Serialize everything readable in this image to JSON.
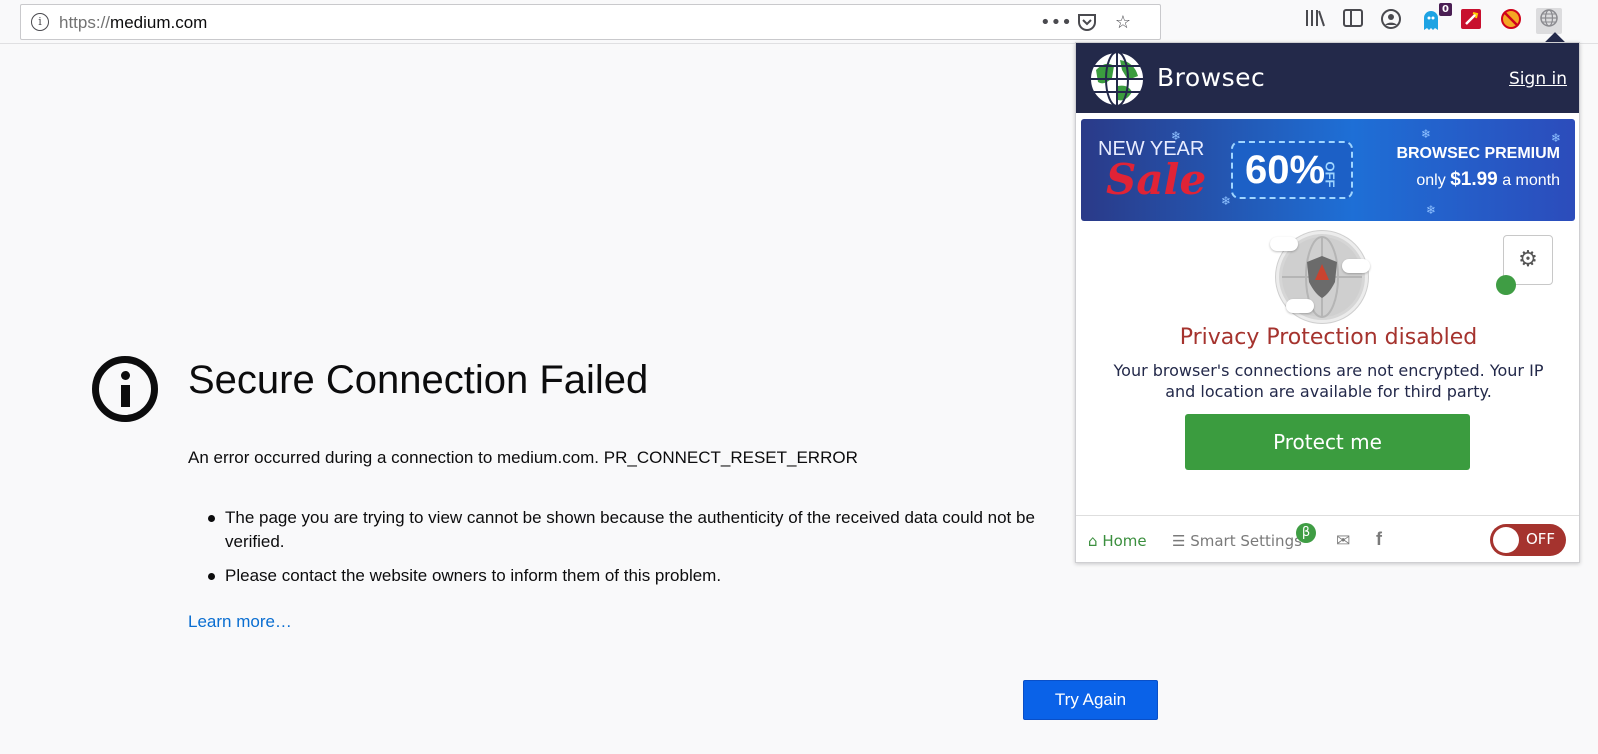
{
  "browser": {
    "url_protocol": "https://",
    "url_host": "medium.com",
    "icons": [
      "info-icon",
      "more-icon",
      "pocket-icon",
      "bookmark-star-icon",
      "library-icon",
      "sidebar-icon",
      "account-icon",
      "ghostery-icon",
      "flash-icon",
      "blocker-icon",
      "browsec-icon"
    ],
    "ghostery_badge": "0"
  },
  "error_page": {
    "title": "Secure Connection Failed",
    "description": "An error occurred during a connection to medium.com. PR_CONNECT_RESET_ERROR",
    "bullets": [
      "The page you are trying to view cannot be shown because the authenticity of the received data could not be verified.",
      "Please contact the website owners to inform them of this problem."
    ],
    "learn_more": "Learn more…",
    "try_again": "Try Again",
    "colors": {
      "link": "#0a6ed1",
      "button": "#0a62e8"
    }
  },
  "browsec": {
    "brand": "Browsec",
    "sign_in": "Sign in",
    "banner": {
      "line1": "NEW YEAR",
      "line2": "Sale",
      "discount": "60%",
      "discount_suffix": "OFF",
      "headline": "BROWSEC PREMIUM",
      "price_prefix": "only",
      "price": "$1.99",
      "price_suffix": "a month"
    },
    "status_title": "Privacy Protection disabled",
    "status_desc": "Your browser's connections are not encrypted. Your IP and location are available for third party.",
    "protect_button": "Protect me",
    "footer": {
      "home": "Home",
      "smart_settings": "Smart Settings",
      "beta": "β",
      "toggle_label": "OFF"
    },
    "colors": {
      "header": "#23294a",
      "disabled": "#a5332e",
      "green": "#3b9c3f"
    }
  }
}
